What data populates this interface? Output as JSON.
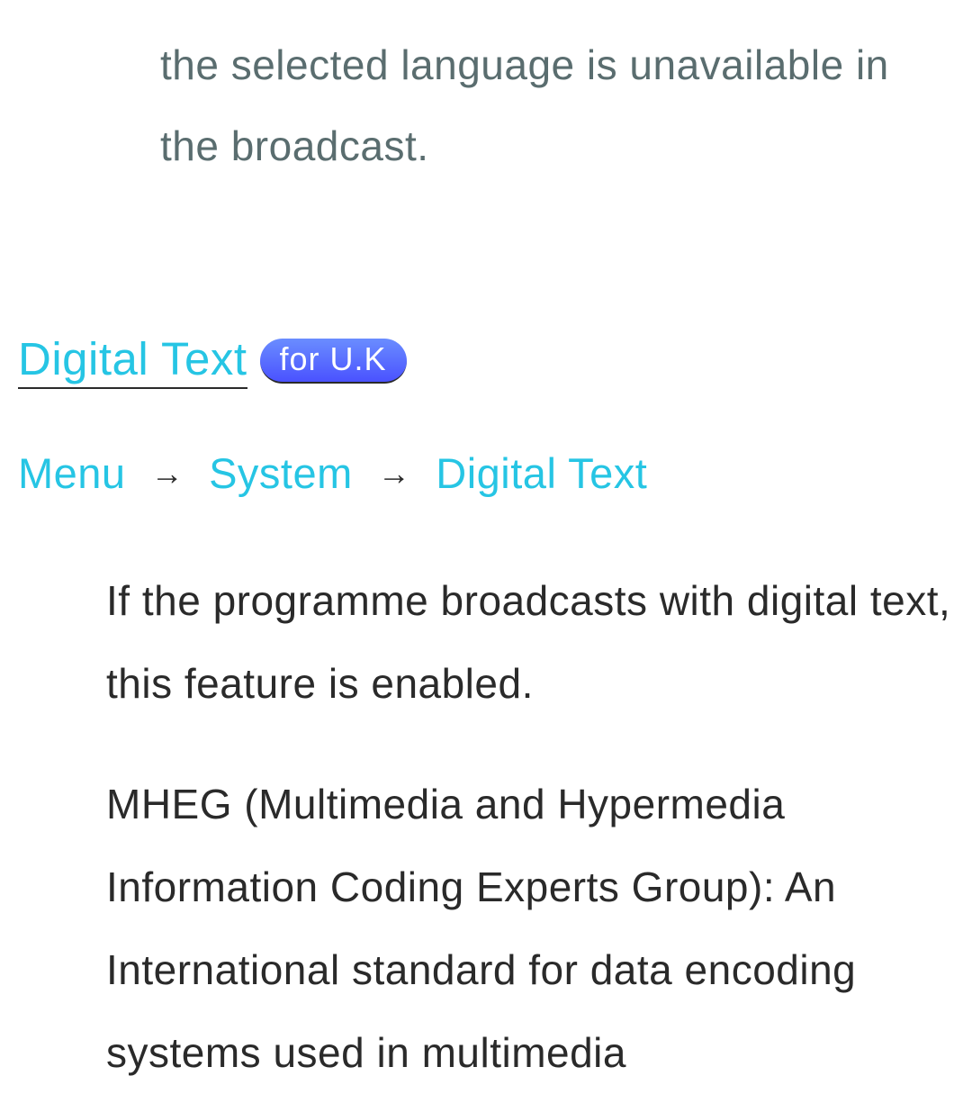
{
  "topFragment": "the selected language is unavailable in the broadcast.",
  "heading": {
    "title": "Digital Text",
    "badge": "for U.K"
  },
  "breadcrumb": {
    "item1": "Menu",
    "item2": "System",
    "item3": "Digital Text"
  },
  "body": {
    "p1": "If the programme broadcasts with digital text, this feature is enabled.",
    "p2": "MHEG (Multimedia and Hypermedia Information Coding Experts Group): An International standard for data encoding systems used in multimedia"
  },
  "arrowGlyph": "→"
}
